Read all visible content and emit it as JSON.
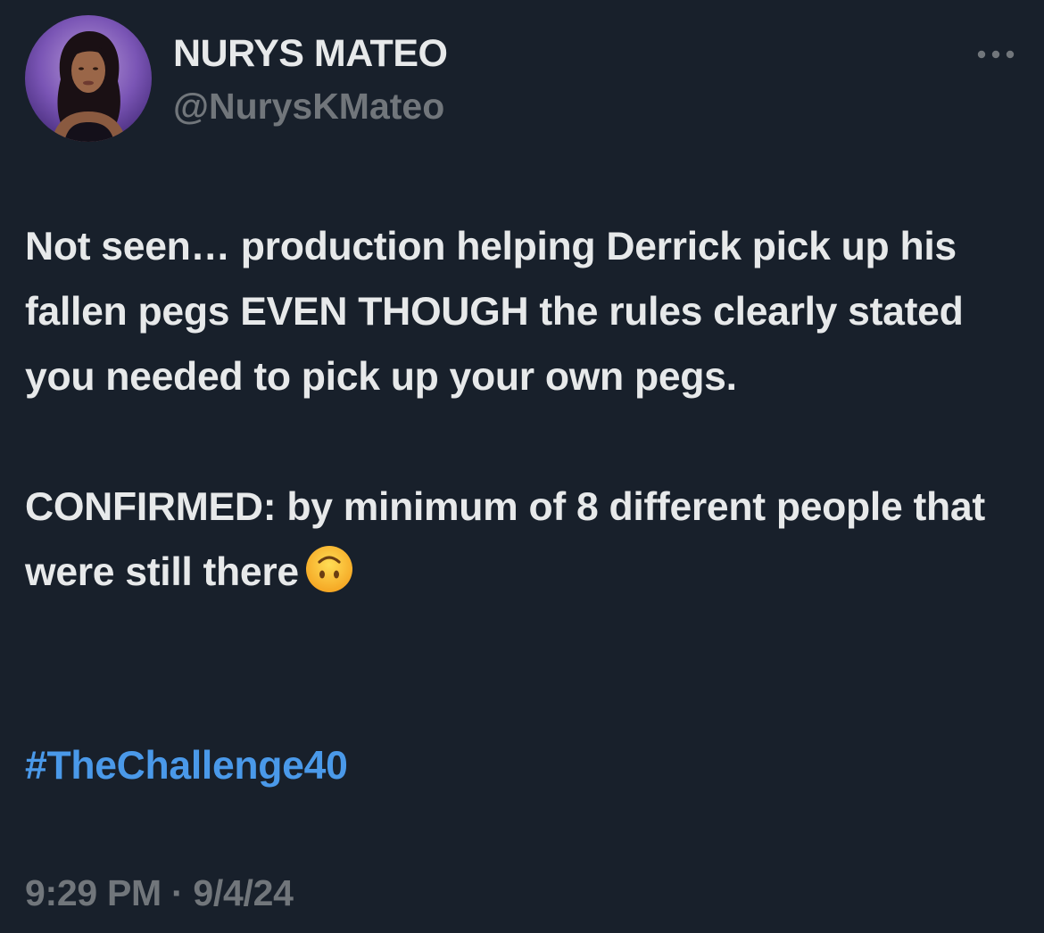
{
  "author": {
    "display_name": "NURYS MATEO",
    "handle": "@NurysKMateo",
    "avatar_icon": "profile-photo"
  },
  "more_icon": "more-horizontal-icon",
  "tweet": {
    "paragraph_1": "Not seen… production helping Derrick pick up his fallen pegs EVEN THOUGH the rules clearly stated you needed to pick up your own pegs.",
    "paragraph_2": "CONFIRMED: by minimum of 8 different people that were still there",
    "emoji": "upside-down-face-emoji",
    "hashtag": "#TheChallenge40"
  },
  "meta": {
    "time": "9:29 PM",
    "separator": "·",
    "date": "9/4/24"
  },
  "colors": {
    "background": "#18202b",
    "text": "#e7e9ea",
    "secondary_text": "#71767b",
    "link": "#4a99e9"
  }
}
